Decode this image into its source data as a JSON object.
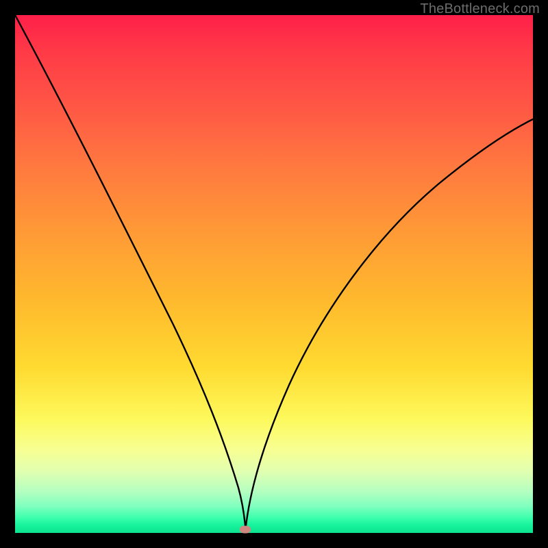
{
  "watermark": "TheBottleneck.com",
  "marker": {
    "x_frac": 0.445,
    "y_frac": 0.993
  },
  "chart_data": {
    "type": "line",
    "title": "",
    "xlabel": "",
    "ylabel": "",
    "xlim": [
      0,
      1
    ],
    "ylim": [
      0,
      1
    ],
    "series": [
      {
        "name": "left-branch",
        "x": [
          0.0,
          0.05,
          0.1,
          0.15,
          0.2,
          0.25,
          0.3,
          0.35,
          0.4,
          0.43,
          0.445
        ],
        "y": [
          1.0,
          0.87,
          0.74,
          0.62,
          0.5,
          0.39,
          0.29,
          0.19,
          0.09,
          0.03,
          0.007
        ]
      },
      {
        "name": "right-branch",
        "x": [
          0.445,
          0.48,
          0.52,
          0.58,
          0.65,
          0.72,
          0.8,
          0.88,
          0.95,
          1.0
        ],
        "y": [
          0.007,
          0.08,
          0.17,
          0.3,
          0.43,
          0.54,
          0.64,
          0.72,
          0.78,
          0.8
        ]
      }
    ],
    "marker_point": {
      "x": 0.445,
      "y": 0.007
    },
    "gradient_stops": [
      {
        "pos": 0.0,
        "color": "#ff1f49"
      },
      {
        "pos": 0.3,
        "color": "#ff7b3f"
      },
      {
        "pos": 0.68,
        "color": "#ffda30"
      },
      {
        "pos": 0.88,
        "color": "#e2ffb0"
      },
      {
        "pos": 1.0,
        "color": "#0de28f"
      }
    ]
  }
}
